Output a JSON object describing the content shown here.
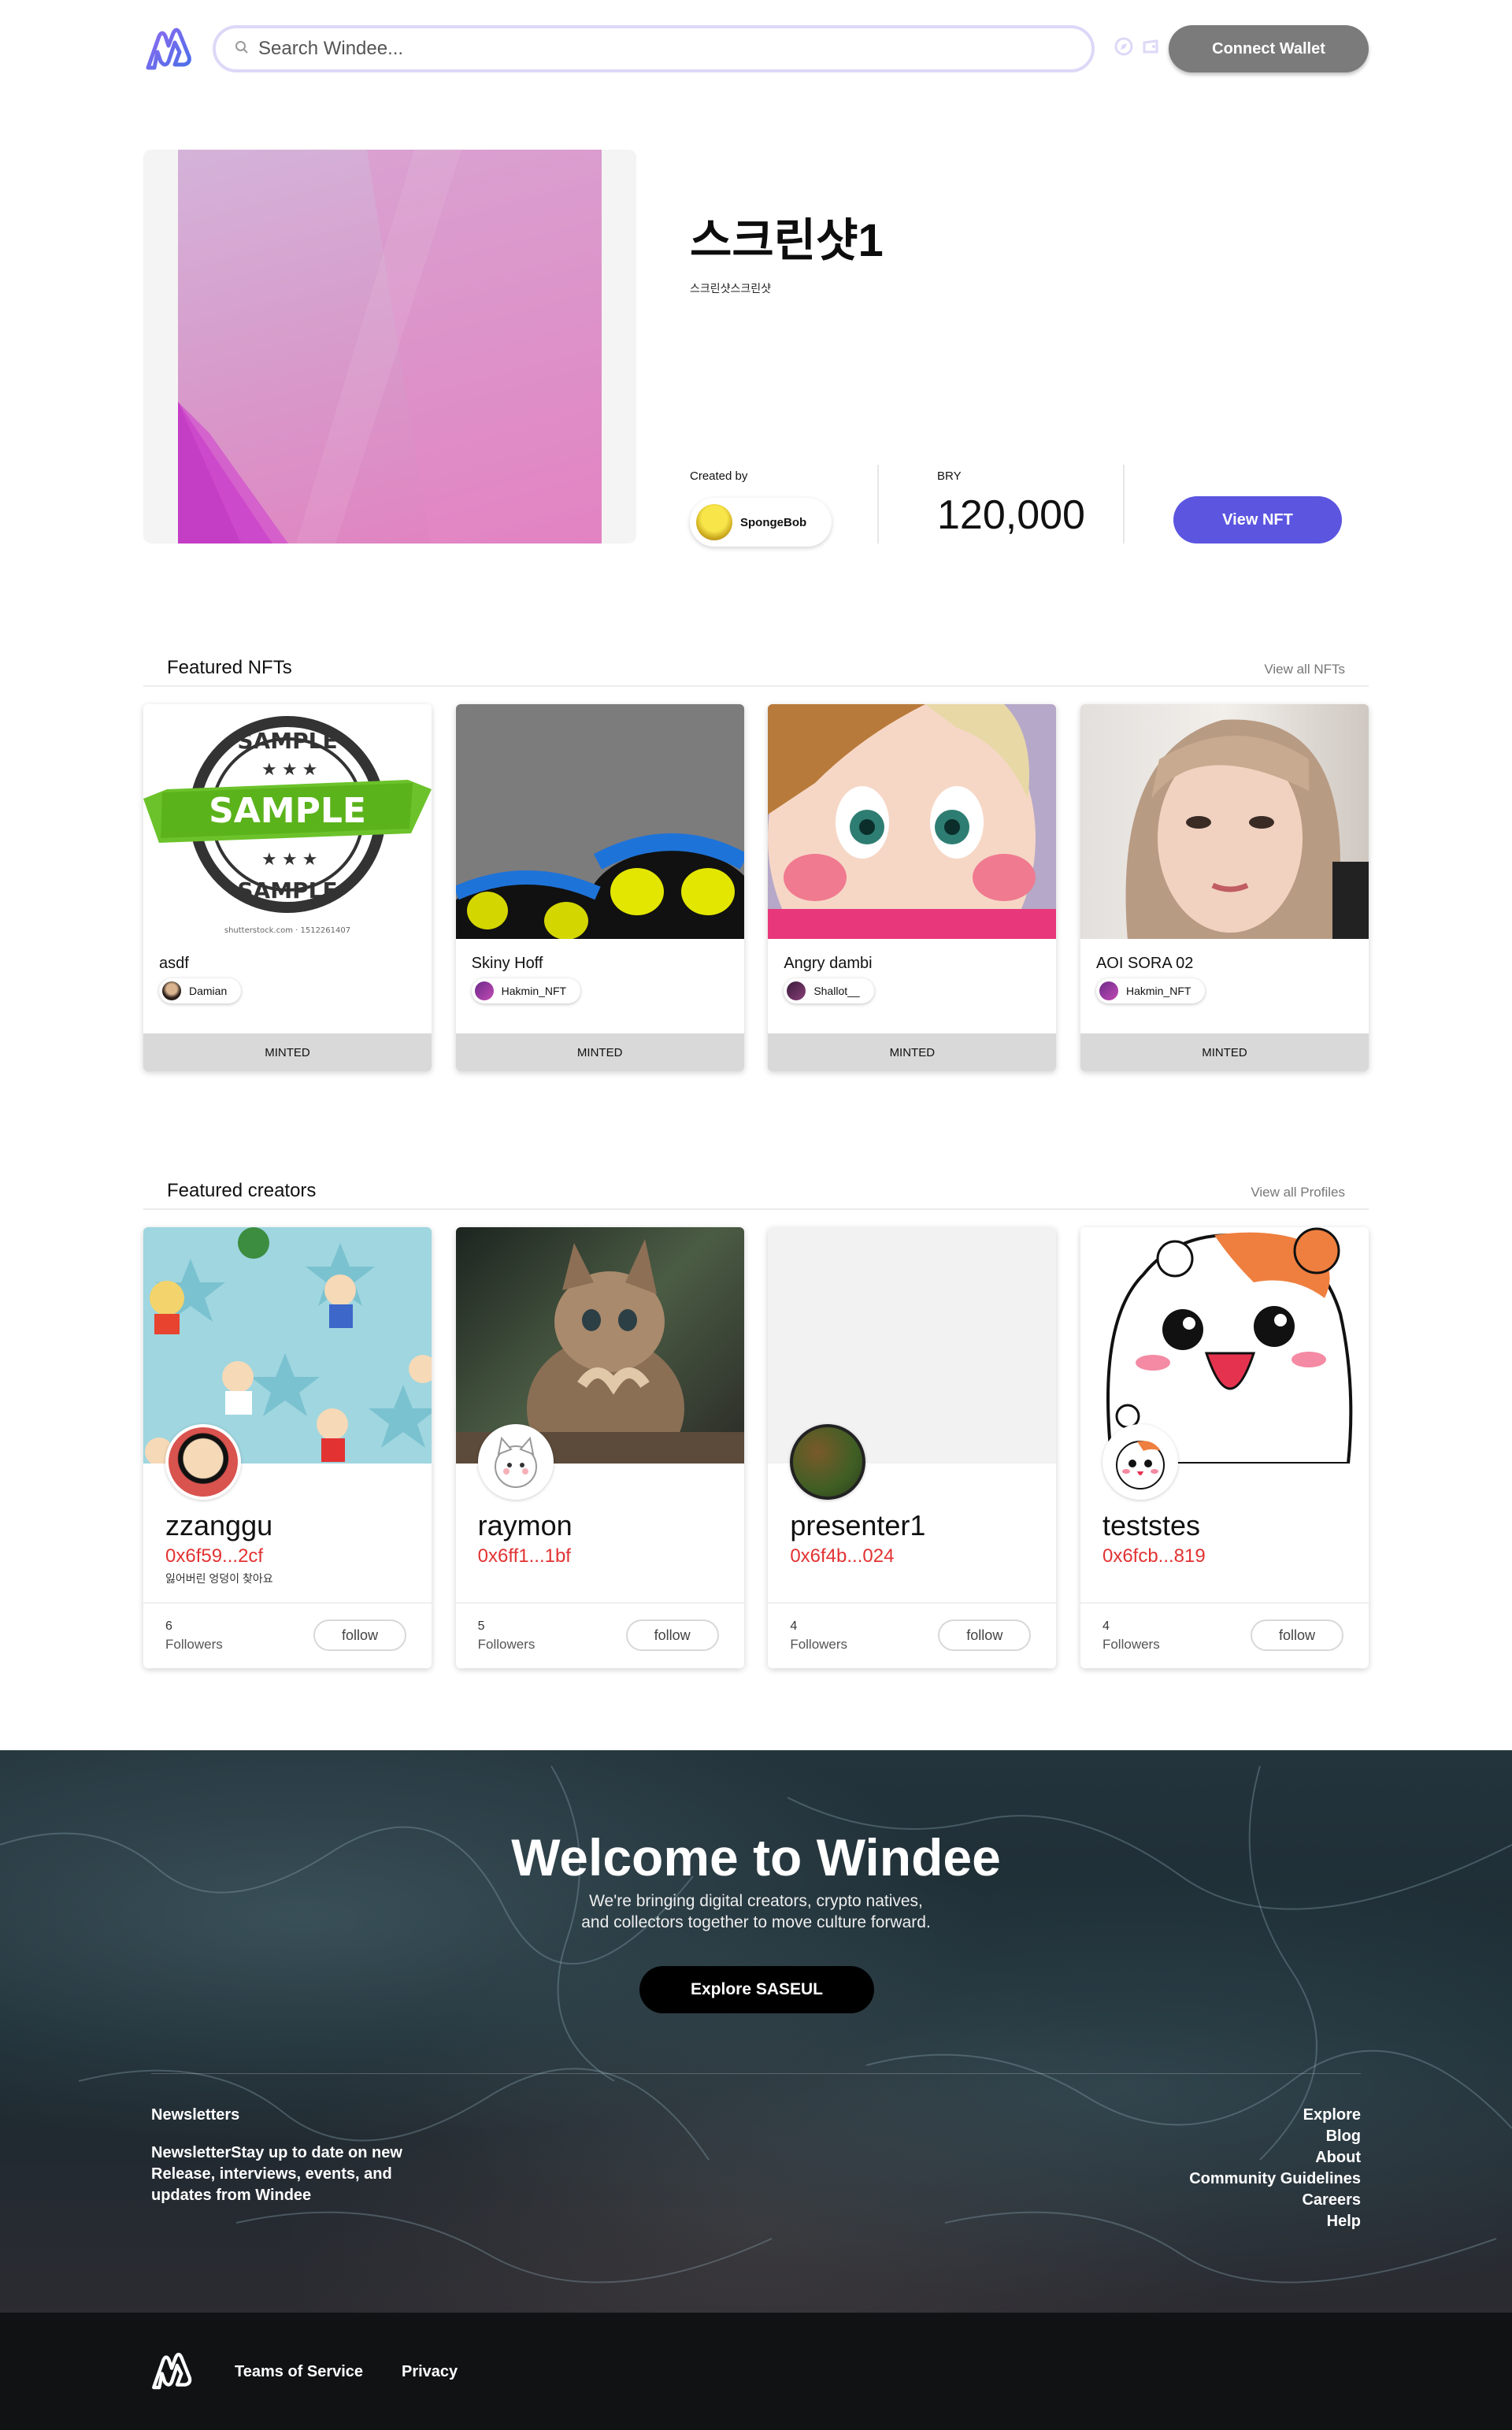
{
  "header": {
    "search_placeholder": "Search Windee...",
    "connect_label": "Connect Wallet"
  },
  "hero": {
    "title": "스크린샷1",
    "subtitle": "스크린샷스크린샷",
    "created_by_label": "Created by",
    "creator": "SpongeBob",
    "currency_label": "BRY",
    "price": "120,000",
    "view_label": "View NFT"
  },
  "featured_nfts": {
    "title": "Featured NFTs",
    "link": "View all NFTs",
    "items": [
      {
        "name": "asdf",
        "owner": "Damian",
        "status": "MINTED"
      },
      {
        "name": "Skiny Hoff",
        "owner": "Hakmin_NFT",
        "status": "MINTED"
      },
      {
        "name": "Angry dambi",
        "owner": "Shallot__",
        "status": "MINTED"
      },
      {
        "name": "AOI SORA 02",
        "owner": "Hakmin_NFT",
        "status": "MINTED"
      }
    ],
    "sample_stamp": {
      "top": "SAMPLE",
      "main": "SAMPLE",
      "bottom": "SAMPLE",
      "caption": "shutterstock.com · 1512261407"
    }
  },
  "featured_creators": {
    "title": "Featured creators",
    "link": "View all Profiles",
    "followers_label": "Followers",
    "follow_label": "follow",
    "items": [
      {
        "name": "zzanggu",
        "address": "0x6f59...2cf",
        "bio": "잃어버린 엉덩이 찾아요",
        "followers": "6"
      },
      {
        "name": "raymon",
        "address": "0x6ff1...1bf",
        "bio": "",
        "followers": "5"
      },
      {
        "name": "presenter1",
        "address": "0x6f4b...024",
        "bio": "",
        "followers": "4"
      },
      {
        "name": "teststes",
        "address": "0x6fcb...819",
        "bio": "",
        "followers": "4"
      }
    ]
  },
  "welcome": {
    "title": "Welcome to Windee",
    "line1": "We're bringing digital creators, crypto natives,",
    "line2": "and collectors together to move culture forward.",
    "explore_label": "Explore SASEUL",
    "newsletter_title": "Newsletters",
    "newsletter_text": "NewsletterStay up to date on new Release, interviews, events, and updates from Windee",
    "links": [
      "Explore",
      "Blog",
      "About",
      "Community Guidelines",
      "Careers",
      "Help"
    ]
  },
  "bottom": {
    "terms": "Teams of Service",
    "privacy": "Privacy"
  },
  "colors": {
    "brand": "#5b55e0",
    "address": "#e23232",
    "connect_button": "#7b7b7b"
  },
  "icons": [
    "windee-logo-icon",
    "search-icon",
    "compass-icon",
    "wallet-icon"
  ]
}
